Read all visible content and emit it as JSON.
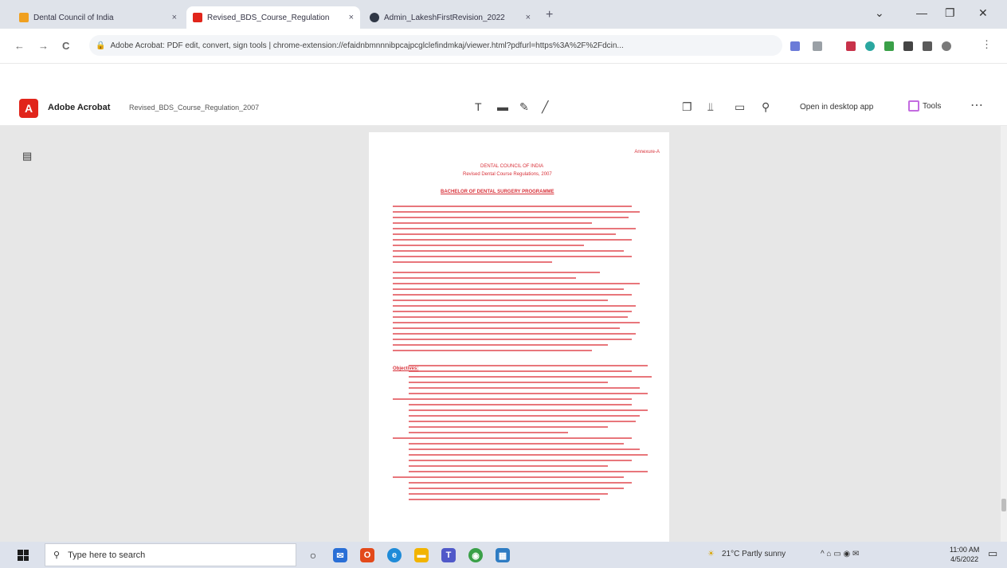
{
  "browser": {
    "tabs": [
      {
        "label": "Dental Council of India",
        "close": "×",
        "color": "#f0a020"
      },
      {
        "label": "Revised_BDS_Course_Regulation",
        "close": "×",
        "color": "#e1251b"
      },
      {
        "label": "Admin_LakeshFirstRevision_2022",
        "close": "×",
        "color": "#303846"
      }
    ],
    "new_tab": "+",
    "window_controls": {
      "chevron": "⌄",
      "minimize": "—",
      "maximize": "❐",
      "close": "✕"
    },
    "nav": {
      "back": "←",
      "forward": "→",
      "reload": "C"
    },
    "url": "Adobe Acrobat: PDF edit, convert, sign tools | chrome-extension://efaidnbmnnnibpcajpcglclefindmkaj/viewer.html?pdfurl=https%3A%2F%2Fdcin...",
    "site_icon": "🔒"
  },
  "acrobat": {
    "app_name": "Adobe Acrobat",
    "logo_glyph": "A",
    "file_name": "Revised_BDS_Course_Regulation_2007",
    "center_tools": [
      "T",
      "▬",
      "✎",
      "╱"
    ],
    "right_tools": [
      "❐",
      "⫫",
      "▭",
      "⚲"
    ],
    "open_desktop_label": "Open in desktop app",
    "tools_label": "Tools",
    "more": "⋯",
    "sidebar_icon": "▤"
  },
  "document": {
    "header_right": "Annexure-A",
    "title_1": "DENTAL COUNCIL OF INDIA",
    "title_2": "Revised Dental Course Regulations, 2007",
    "section_heading": "BACHELOR OF DENTAL SURGERY PROGRAMME",
    "objectives_heading": "Objectives:"
  },
  "taskbar": {
    "search_placeholder": "Type here to search",
    "weather": "21°C  Partly sunny",
    "tray_icons": "^ ⌂ ▭ ◉ ✉",
    "time": "11:00 AM",
    "date": "4/5/2022"
  }
}
